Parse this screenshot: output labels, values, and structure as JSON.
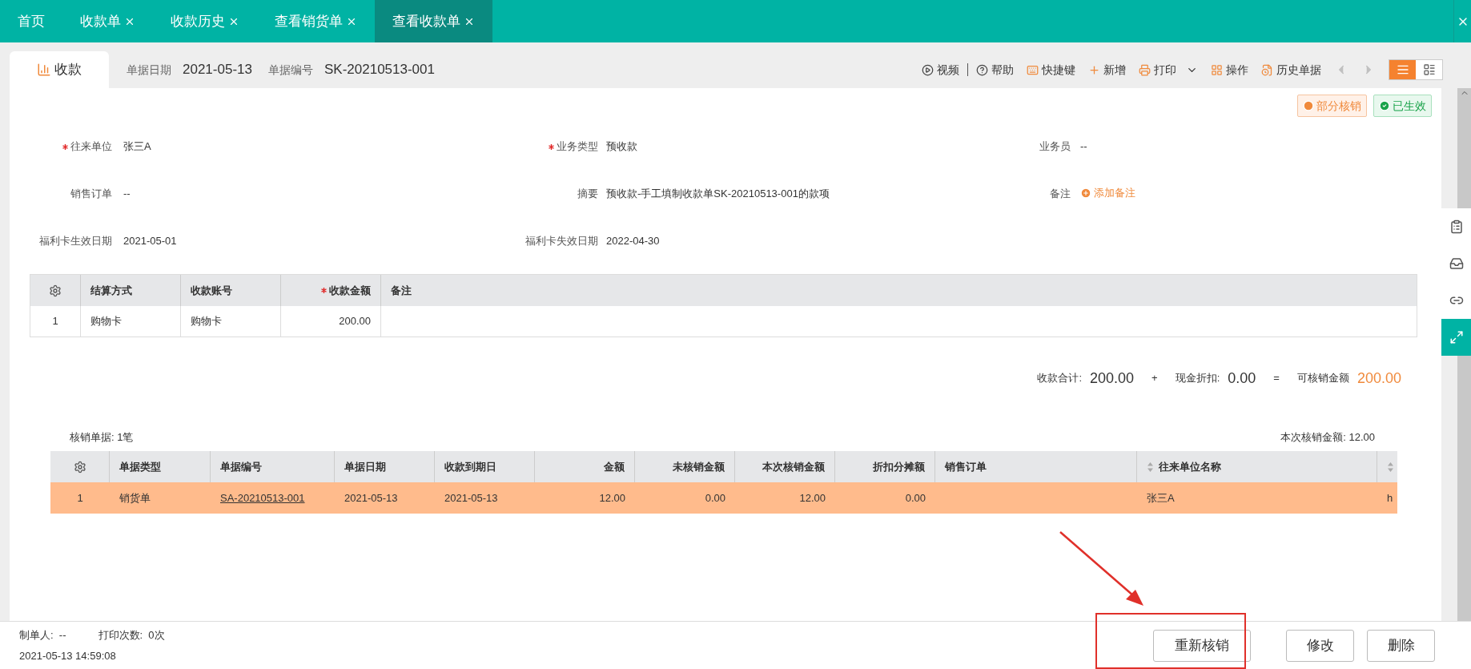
{
  "tabs": [
    {
      "label": "首页",
      "selected": false,
      "closable": false
    },
    {
      "label": "收款单",
      "selected": false,
      "closable": true
    },
    {
      "label": "收款历史",
      "selected": false,
      "closable": true
    },
    {
      "label": "查看销货单",
      "selected": false,
      "closable": true
    },
    {
      "label": "查看收款单",
      "selected": true,
      "closable": true
    }
  ],
  "doc_tab": {
    "label": "收款"
  },
  "doc_meta": [
    {
      "label": "单据日期",
      "value": "2021-05-13"
    },
    {
      "label": "单据编号",
      "value": "SK-20210513-001"
    }
  ],
  "toolbar": [
    {
      "kind": "video",
      "label": "视频"
    },
    {
      "kind": "help",
      "label": "帮助"
    },
    {
      "kind": "keyboard",
      "label": "快捷键"
    },
    {
      "kind": "add",
      "label": "新增"
    },
    {
      "kind": "print",
      "label": "打印",
      "dropdown": true
    },
    {
      "kind": "operate",
      "label": "操作"
    },
    {
      "kind": "history",
      "label": "历史单据"
    }
  ],
  "pager": {
    "prev_disabled": true,
    "next_disabled": true
  },
  "view_modes": [
    {
      "kind": "list",
      "selected": true
    },
    {
      "kind": "detail",
      "selected": false
    }
  ],
  "status_badges": [
    {
      "kind": "partial",
      "label": "部分核销"
    },
    {
      "kind": "effective",
      "label": "已生效"
    }
  ],
  "form_rows": [
    [
      {
        "label": "往来单位",
        "value": "张三A",
        "required": true
      },
      {
        "label": "业务类型",
        "value": "预收款",
        "required": true
      },
      {
        "label": "业务员",
        "value": "--",
        "required": false
      }
    ],
    [
      {
        "label": "销售订单",
        "value": "--",
        "required": false
      },
      {
        "label": "摘要",
        "value": "预收款-手工填制收款单SK-20210513-001的款项",
        "required": false
      },
      {
        "label": "备注",
        "action": "添加备注",
        "required": false
      }
    ],
    [
      {
        "label": "福利卡生效日期",
        "value": "2021-05-01",
        "required": false
      },
      {
        "label": "福利卡失效日期",
        "value": "2022-04-30",
        "required": false
      }
    ]
  ],
  "payment_table": {
    "columns": [
      {
        "label": "结算方式",
        "required": false
      },
      {
        "label": "收款账号",
        "required": false
      },
      {
        "label": "收款金额",
        "required": true
      },
      {
        "label": "备注",
        "required": false
      }
    ],
    "rows": [
      {
        "index": "1",
        "cells": [
          "购物卡",
          "购物卡",
          "200.00",
          null
        ]
      }
    ]
  },
  "summary": [
    {
      "label": "收款合计:",
      "value": "200.00",
      "highlight": false
    },
    {
      "operator": "+"
    },
    {
      "label": "现金折扣:",
      "value": "0.00",
      "highlight": false
    },
    {
      "operator": "="
    },
    {
      "label": "可核销金额",
      "value": "200.00",
      "highlight": true
    }
  ],
  "writeoff": {
    "count_label": "核销单据: 1笔",
    "amount_label": "本次核销金额: 12.00",
    "columns": [
      {
        "label": "单据类型",
        "sortable": false
      },
      {
        "label": "单据编号",
        "sortable": false
      },
      {
        "label": "单据日期",
        "sortable": false
      },
      {
        "label": "收款到期日",
        "sortable": false
      },
      {
        "label": "金额",
        "sortable": false
      },
      {
        "label": "未核销金额",
        "sortable": false
      },
      {
        "label": "本次核销金额",
        "sortable": false
      },
      {
        "label": "折扣分摊额",
        "sortable": false
      },
      {
        "label": "销售订单",
        "sortable": false
      },
      {
        "label": "往来单位名称",
        "sortable": true
      },
      {
        "sortable": true
      }
    ],
    "rows": [
      {
        "index": "1",
        "selected": true,
        "cells": [
          "销货单",
          "SA-20210513-001",
          "2021-05-13",
          "2021-05-13",
          "12.00",
          "0.00",
          "12.00",
          "0.00",
          null,
          "张三A",
          "h"
        ]
      }
    ]
  },
  "footer": {
    "creator": "制单人:  --",
    "print_count": "打印次数:  0次",
    "timestamp": "2021-05-13 14:59:08"
  },
  "actions": [
    {
      "label": "重新核销"
    },
    {
      "label": "修改"
    },
    {
      "label": "删除"
    }
  ]
}
